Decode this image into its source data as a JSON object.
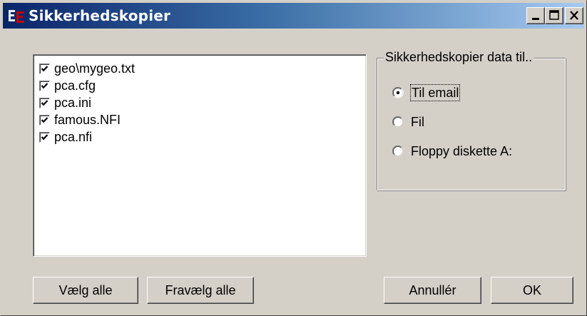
{
  "window": {
    "title": "Sikkerhedskopier",
    "title_gradient_start": "#0a246a",
    "title_gradient_end": "#a6caf0",
    "face_color": "#d4d0c8"
  },
  "caption_buttons": {
    "minimize_icon": "minimize-icon",
    "maximize_icon": "maximize-icon",
    "close_icon": "close-icon"
  },
  "files": [
    {
      "label": "geo\\mygeo.txt",
      "checked": true
    },
    {
      "label": "pca.cfg",
      "checked": true
    },
    {
      "label": "pca.ini",
      "checked": true
    },
    {
      "label": "famous.NFI",
      "checked": true
    },
    {
      "label": "pca.nfi",
      "checked": true
    }
  ],
  "backup_target": {
    "group_title": "Sikkerhedskopier data til..",
    "options": [
      {
        "label": "Til email",
        "selected": true
      },
      {
        "label": "Fil",
        "selected": false
      },
      {
        "label": "Floppy diskette A:",
        "selected": false
      }
    ]
  },
  "buttons": {
    "select_all": "Vælg alle",
    "deselect_all": "Fravælg alle",
    "cancel": "Annullér",
    "ok": "OK"
  }
}
